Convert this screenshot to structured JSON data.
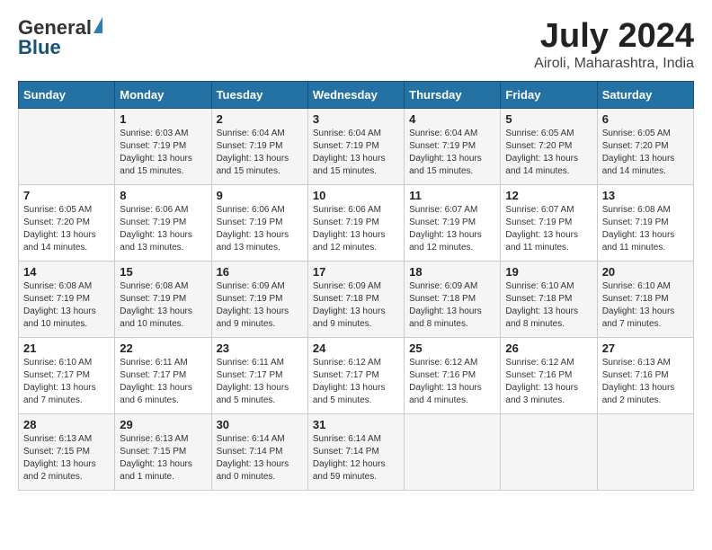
{
  "header": {
    "logo_general": "General",
    "logo_blue": "Blue",
    "month_title": "July 2024",
    "location": "Airoli, Maharashtra, India"
  },
  "days_of_week": [
    "Sunday",
    "Monday",
    "Tuesday",
    "Wednesday",
    "Thursday",
    "Friday",
    "Saturday"
  ],
  "weeks": [
    [
      {
        "day": "",
        "sunrise": "",
        "sunset": "",
        "daylight": ""
      },
      {
        "day": "1",
        "sunrise": "Sunrise: 6:03 AM",
        "sunset": "Sunset: 7:19 PM",
        "daylight": "Daylight: 13 hours and 15 minutes."
      },
      {
        "day": "2",
        "sunrise": "Sunrise: 6:04 AM",
        "sunset": "Sunset: 7:19 PM",
        "daylight": "Daylight: 13 hours and 15 minutes."
      },
      {
        "day": "3",
        "sunrise": "Sunrise: 6:04 AM",
        "sunset": "Sunset: 7:19 PM",
        "daylight": "Daylight: 13 hours and 15 minutes."
      },
      {
        "day": "4",
        "sunrise": "Sunrise: 6:04 AM",
        "sunset": "Sunset: 7:19 PM",
        "daylight": "Daylight: 13 hours and 15 minutes."
      },
      {
        "day": "5",
        "sunrise": "Sunrise: 6:05 AM",
        "sunset": "Sunset: 7:20 PM",
        "daylight": "Daylight: 13 hours and 14 minutes."
      },
      {
        "day": "6",
        "sunrise": "Sunrise: 6:05 AM",
        "sunset": "Sunset: 7:20 PM",
        "daylight": "Daylight: 13 hours and 14 minutes."
      }
    ],
    [
      {
        "day": "7",
        "sunrise": "Sunrise: 6:05 AM",
        "sunset": "Sunset: 7:20 PM",
        "daylight": "Daylight: 13 hours and 14 minutes."
      },
      {
        "day": "8",
        "sunrise": "Sunrise: 6:06 AM",
        "sunset": "Sunset: 7:19 PM",
        "daylight": "Daylight: 13 hours and 13 minutes."
      },
      {
        "day": "9",
        "sunrise": "Sunrise: 6:06 AM",
        "sunset": "Sunset: 7:19 PM",
        "daylight": "Daylight: 13 hours and 13 minutes."
      },
      {
        "day": "10",
        "sunrise": "Sunrise: 6:06 AM",
        "sunset": "Sunset: 7:19 PM",
        "daylight": "Daylight: 13 hours and 12 minutes."
      },
      {
        "day": "11",
        "sunrise": "Sunrise: 6:07 AM",
        "sunset": "Sunset: 7:19 PM",
        "daylight": "Daylight: 13 hours and 12 minutes."
      },
      {
        "day": "12",
        "sunrise": "Sunrise: 6:07 AM",
        "sunset": "Sunset: 7:19 PM",
        "daylight": "Daylight: 13 hours and 11 minutes."
      },
      {
        "day": "13",
        "sunrise": "Sunrise: 6:08 AM",
        "sunset": "Sunset: 7:19 PM",
        "daylight": "Daylight: 13 hours and 11 minutes."
      }
    ],
    [
      {
        "day": "14",
        "sunrise": "Sunrise: 6:08 AM",
        "sunset": "Sunset: 7:19 PM",
        "daylight": "Daylight: 13 hours and 10 minutes."
      },
      {
        "day": "15",
        "sunrise": "Sunrise: 6:08 AM",
        "sunset": "Sunset: 7:19 PM",
        "daylight": "Daylight: 13 hours and 10 minutes."
      },
      {
        "day": "16",
        "sunrise": "Sunrise: 6:09 AM",
        "sunset": "Sunset: 7:19 PM",
        "daylight": "Daylight: 13 hours and 9 minutes."
      },
      {
        "day": "17",
        "sunrise": "Sunrise: 6:09 AM",
        "sunset": "Sunset: 7:18 PM",
        "daylight": "Daylight: 13 hours and 9 minutes."
      },
      {
        "day": "18",
        "sunrise": "Sunrise: 6:09 AM",
        "sunset": "Sunset: 7:18 PM",
        "daylight": "Daylight: 13 hours and 8 minutes."
      },
      {
        "day": "19",
        "sunrise": "Sunrise: 6:10 AM",
        "sunset": "Sunset: 7:18 PM",
        "daylight": "Daylight: 13 hours and 8 minutes."
      },
      {
        "day": "20",
        "sunrise": "Sunrise: 6:10 AM",
        "sunset": "Sunset: 7:18 PM",
        "daylight": "Daylight: 13 hours and 7 minutes."
      }
    ],
    [
      {
        "day": "21",
        "sunrise": "Sunrise: 6:10 AM",
        "sunset": "Sunset: 7:17 PM",
        "daylight": "Daylight: 13 hours and 7 minutes."
      },
      {
        "day": "22",
        "sunrise": "Sunrise: 6:11 AM",
        "sunset": "Sunset: 7:17 PM",
        "daylight": "Daylight: 13 hours and 6 minutes."
      },
      {
        "day": "23",
        "sunrise": "Sunrise: 6:11 AM",
        "sunset": "Sunset: 7:17 PM",
        "daylight": "Daylight: 13 hours and 5 minutes."
      },
      {
        "day": "24",
        "sunrise": "Sunrise: 6:12 AM",
        "sunset": "Sunset: 7:17 PM",
        "daylight": "Daylight: 13 hours and 5 minutes."
      },
      {
        "day": "25",
        "sunrise": "Sunrise: 6:12 AM",
        "sunset": "Sunset: 7:16 PM",
        "daylight": "Daylight: 13 hours and 4 minutes."
      },
      {
        "day": "26",
        "sunrise": "Sunrise: 6:12 AM",
        "sunset": "Sunset: 7:16 PM",
        "daylight": "Daylight: 13 hours and 3 minutes."
      },
      {
        "day": "27",
        "sunrise": "Sunrise: 6:13 AM",
        "sunset": "Sunset: 7:16 PM",
        "daylight": "Daylight: 13 hours and 2 minutes."
      }
    ],
    [
      {
        "day": "28",
        "sunrise": "Sunrise: 6:13 AM",
        "sunset": "Sunset: 7:15 PM",
        "daylight": "Daylight: 13 hours and 2 minutes."
      },
      {
        "day": "29",
        "sunrise": "Sunrise: 6:13 AM",
        "sunset": "Sunset: 7:15 PM",
        "daylight": "Daylight: 13 hours and 1 minute."
      },
      {
        "day": "30",
        "sunrise": "Sunrise: 6:14 AM",
        "sunset": "Sunset: 7:14 PM",
        "daylight": "Daylight: 13 hours and 0 minutes."
      },
      {
        "day": "31",
        "sunrise": "Sunrise: 6:14 AM",
        "sunset": "Sunset: 7:14 PM",
        "daylight": "Daylight: 12 hours and 59 minutes."
      },
      {
        "day": "",
        "sunrise": "",
        "sunset": "",
        "daylight": ""
      },
      {
        "day": "",
        "sunrise": "",
        "sunset": "",
        "daylight": ""
      },
      {
        "day": "",
        "sunrise": "",
        "sunset": "",
        "daylight": ""
      }
    ]
  ]
}
